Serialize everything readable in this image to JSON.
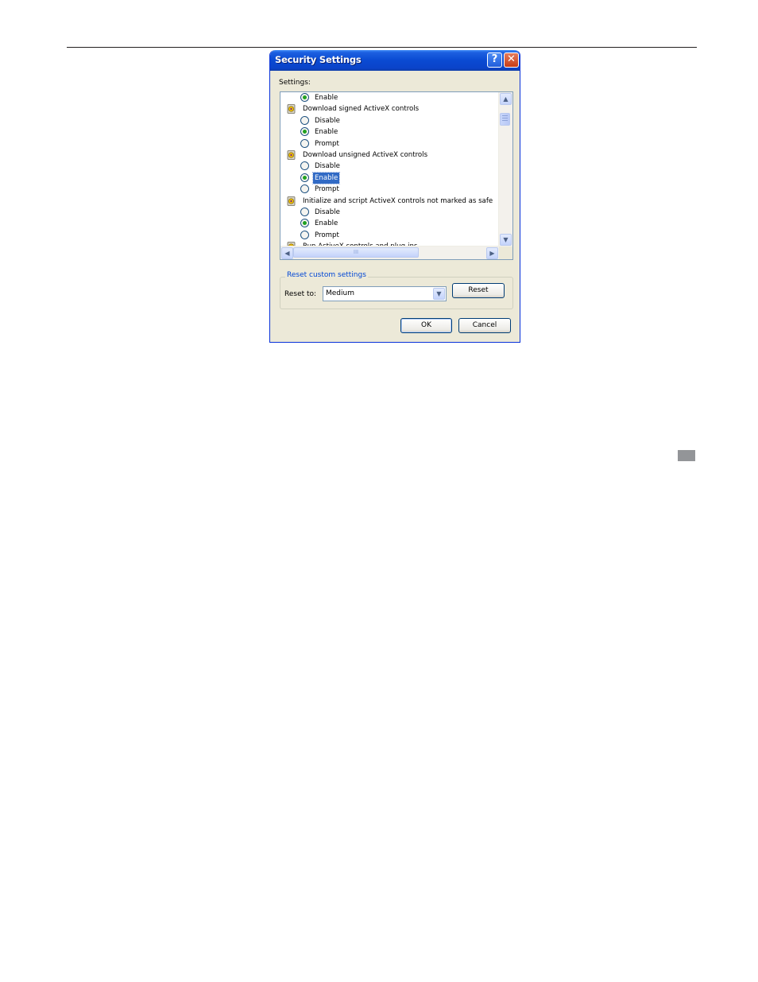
{
  "dialog": {
    "title": "Security Settings",
    "help_glyph": "?",
    "close_glyph": "✕",
    "settings_label": "Settings:"
  },
  "settings_list": {
    "rows": [
      {
        "type": "option",
        "label": "Enable",
        "checked": true
      },
      {
        "type": "group",
        "label": "Download signed ActiveX controls"
      },
      {
        "type": "option",
        "label": "Disable",
        "checked": false
      },
      {
        "type": "option",
        "label": "Enable",
        "checked": true
      },
      {
        "type": "option",
        "label": "Prompt",
        "checked": false
      },
      {
        "type": "group",
        "label": "Download unsigned ActiveX controls"
      },
      {
        "type": "option",
        "label": "Disable",
        "checked": false
      },
      {
        "type": "option",
        "label": "Enable",
        "checked": true,
        "selected": true
      },
      {
        "type": "option",
        "label": "Prompt",
        "checked": false
      },
      {
        "type": "group",
        "label": "Initialize and script ActiveX controls not marked as safe"
      },
      {
        "type": "option",
        "label": "Disable",
        "checked": false
      },
      {
        "type": "option",
        "label": "Enable",
        "checked": true
      },
      {
        "type": "option",
        "label": "Prompt",
        "checked": false
      },
      {
        "type": "group",
        "label": "Run ActiveX controls and plug-ins"
      }
    ],
    "scroll_up_glyph": "▲",
    "scroll_down_glyph": "▼",
    "scroll_left_glyph": "◀",
    "scroll_right_glyph": "▶",
    "hthumb_grip": "III"
  },
  "reset_group": {
    "legend": "Reset custom settings",
    "reset_to_label": "Reset to:",
    "reset_to_value": "Medium",
    "dropdown_glyph": "▼",
    "reset_button": "Reset"
  },
  "footer": {
    "ok_button": "OK",
    "cancel_button": "Cancel"
  },
  "colors": {
    "titlebar": "#0a4ad2",
    "selection": "#316ac5",
    "radio_checked": "#21a121",
    "legend_text": "#0046d5"
  },
  "icons": {
    "group_icon": "shield-gear-icon"
  }
}
